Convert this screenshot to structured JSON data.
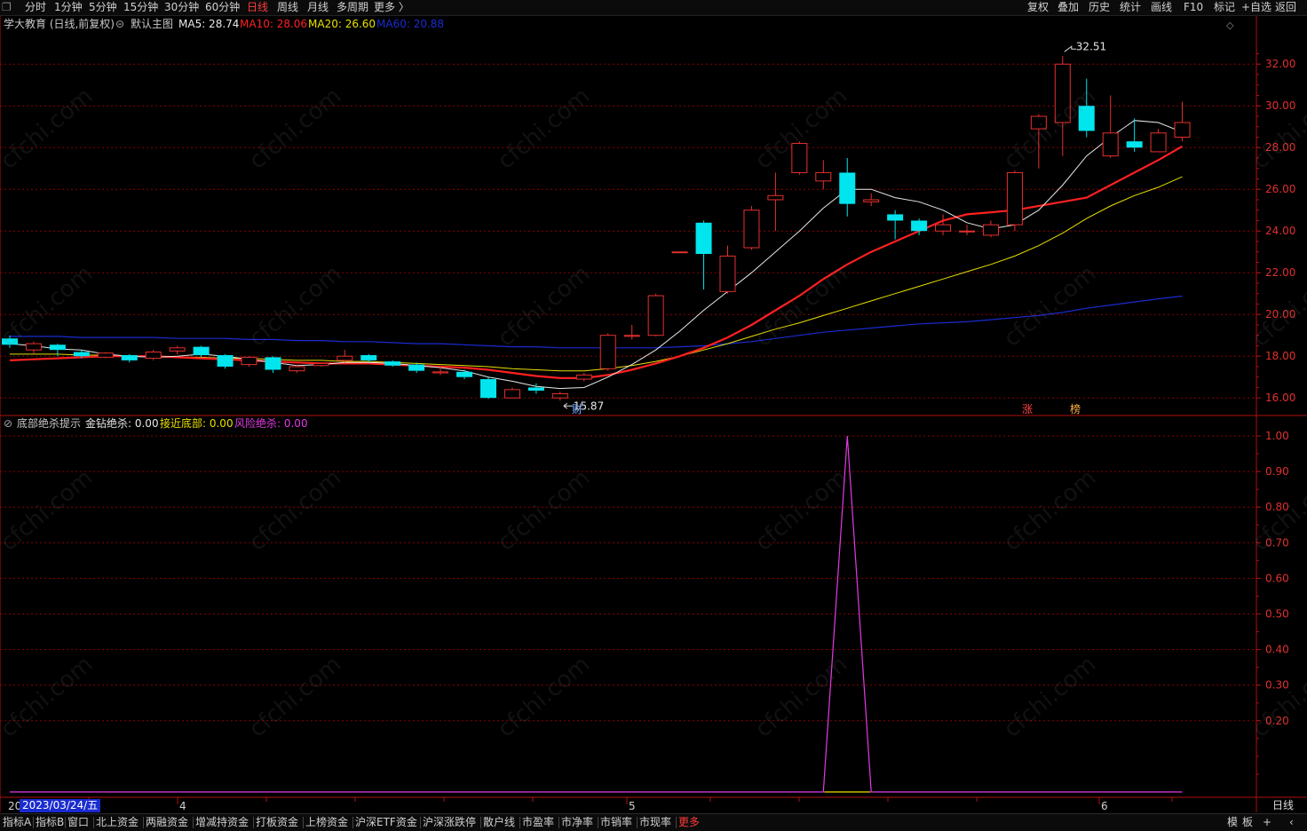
{
  "colors": {
    "up": "#e6302e",
    "down": "#00e5ee",
    "ma5": "#e8e8e8",
    "ma10": "#ff2020",
    "ma20": "#e8e000",
    "ma60": "#1a2bd0",
    "grid": "#8b0000",
    "signal": "#e23ae2"
  },
  "toolbar": {
    "left": [
      "分时",
      "1分钟",
      "5分钟",
      "15分钟",
      "30分钟",
      "60分钟",
      "日线",
      "周线",
      "月线",
      "多周期",
      "更多 〉"
    ],
    "active": "日线",
    "right": [
      "复权",
      "叠加",
      "历史",
      "统计",
      "画线",
      "F10",
      "标记",
      "+自选",
      "返回"
    ],
    "corner_icon": "expand-icon"
  },
  "main_panel": {
    "stock": "学大教育 (日线,前复权)",
    "template_icon": "circle-chevron-icon",
    "template": "默认主图",
    "ma_labels": [
      {
        "text": "MA5: 28.74",
        "color": "#e8e8e8"
      },
      {
        "text": "MA10: 28.06",
        "color": "#ff2020"
      },
      {
        "text": "MA20: 26.60",
        "color": "#e8e000"
      },
      {
        "text": "MA60: 20.88",
        "color": "#1a2bd0"
      }
    ],
    "price_axis": [
      "32.00",
      "30.00",
      "28.00",
      "26.00",
      "24.00",
      "22.00",
      "20.00",
      "18.00",
      "16.00"
    ],
    "high_marker": "32.51",
    "low_marker": "15.87",
    "events": [
      {
        "text": "财",
        "color": "#6fa8ff"
      },
      {
        "text": "涨",
        "color": "#ff4040"
      },
      {
        "text": "榜",
        "color": "#ffb040"
      }
    ]
  },
  "sub_panel": {
    "indicator": "底部绝杀提示",
    "labels": [
      {
        "text": "金钻绝杀: 0.00",
        "color": "#e8e8e8"
      },
      {
        "text": "接近底部: 0.00",
        "color": "#e8e000"
      },
      {
        "text": "风险绝杀: 0.00",
        "color": "#e23ae2"
      }
    ],
    "value_axis": [
      "1.00",
      "0.90",
      "0.80",
      "0.70",
      "0.60",
      "0.50",
      "0.40",
      "0.30",
      "0.20"
    ]
  },
  "time_axis": {
    "cursor_date": "2023/03/24/五",
    "year_prefix": "20",
    "months": [
      "4",
      "5",
      "6"
    ],
    "period": "日线"
  },
  "bottom_tabs": [
    "指标A",
    "指标B",
    "窗口",
    "北上资金",
    "两融资金",
    "增减持资金",
    "打板资金",
    "上榜资金",
    "沪深ETF资金",
    "沪深涨跌停",
    "散户线",
    "市盈率",
    "市净率",
    "市销率",
    "市现率",
    "更多"
  ],
  "bottom_right": [
    "模",
    "板",
    "+",
    "‹"
  ],
  "watermark": "cfchi.com",
  "chart_data": [
    {
      "type": "candlestick",
      "ylim": [
        15.2,
        33.5
      ],
      "candles": [
        [
          18.85,
          18.55,
          19.0,
          18.4
        ],
        [
          18.3,
          18.6,
          18.7,
          18.1
        ],
        [
          18.55,
          18.3,
          18.6,
          18.0
        ],
        [
          18.2,
          18.0,
          18.3,
          17.9
        ],
        [
          17.95,
          18.15,
          18.2,
          17.9
        ],
        [
          18.05,
          17.8,
          18.1,
          17.7
        ],
        [
          17.9,
          18.2,
          18.3,
          17.8
        ],
        [
          18.25,
          18.4,
          18.5,
          18.1
        ],
        [
          18.45,
          18.05,
          18.5,
          17.95
        ],
        [
          18.05,
          17.5,
          18.1,
          17.4
        ],
        [
          17.6,
          17.95,
          18.0,
          17.5
        ],
        [
          17.95,
          17.35,
          18.0,
          17.2
        ],
        [
          17.3,
          17.5,
          17.6,
          17.2
        ],
        [
          17.55,
          17.65,
          17.7,
          17.5
        ],
        [
          17.8,
          18.0,
          18.3,
          17.7
        ],
        [
          18.05,
          17.8,
          18.1,
          17.7
        ],
        [
          17.75,
          17.55,
          17.8,
          17.5
        ],
        [
          17.6,
          17.3,
          17.7,
          17.2
        ],
        [
          17.2,
          17.25,
          17.5,
          17.1
        ],
        [
          17.25,
          17.0,
          17.35,
          16.9
        ],
        [
          16.9,
          16.0,
          17.0,
          15.95
        ],
        [
          16.0,
          16.4,
          16.5,
          16.0
        ],
        [
          16.5,
          16.35,
          16.7,
          16.2
        ],
        [
          16.0,
          16.2,
          16.3,
          15.87
        ],
        [
          16.9,
          17.1,
          17.2,
          16.8
        ],
        [
          17.4,
          19.0,
          19.1,
          17.3
        ],
        [
          18.95,
          19.0,
          19.5,
          18.8
        ],
        [
          19.0,
          20.9,
          21.0,
          18.95
        ],
        [
          23.0,
          23.0,
          23.0,
          23.0
        ],
        [
          24.4,
          22.9,
          24.5,
          21.2
        ],
        [
          21.1,
          22.8,
          23.3,
          21.0
        ],
        [
          23.2,
          25.0,
          25.2,
          23.1
        ],
        [
          25.5,
          25.7,
          26.8,
          24.0
        ],
        [
          26.8,
          28.2,
          28.3,
          26.7
        ],
        [
          26.4,
          26.8,
          27.4,
          26.0
        ],
        [
          26.8,
          25.3,
          27.5,
          24.7
        ],
        [
          25.4,
          25.5,
          25.8,
          25.2
        ],
        [
          24.8,
          24.5,
          25.0,
          23.6
        ],
        [
          24.5,
          24.0,
          24.6,
          23.8
        ],
        [
          24.0,
          24.3,
          24.8,
          23.8
        ],
        [
          24.0,
          24.0,
          24.3,
          23.8
        ],
        [
          23.8,
          24.3,
          24.5,
          23.7
        ],
        [
          24.3,
          26.8,
          26.9,
          24.0
        ],
        [
          28.9,
          29.5,
          29.6,
          27.0
        ],
        [
          29.2,
          32.0,
          32.4,
          27.6
        ],
        [
          30.0,
          28.8,
          31.3,
          28.5
        ],
        [
          27.6,
          28.7,
          30.5,
          27.5
        ],
        [
          28.3,
          28.0,
          29.4,
          27.8
        ],
        [
          27.8,
          28.7,
          28.9,
          27.8
        ],
        [
          28.5,
          29.2,
          30.2,
          28.3
        ]
      ],
      "ma5": [
        18.6,
        18.5,
        18.35,
        18.3,
        18.1,
        18.0,
        17.95,
        18.0,
        18.1,
        18.0,
        17.85,
        17.7,
        17.55,
        17.6,
        17.7,
        17.7,
        17.65,
        17.55,
        17.45,
        17.3,
        17.0,
        16.8,
        16.55,
        16.45,
        16.5,
        17.0,
        17.6,
        18.3,
        19.2,
        20.2,
        21.1,
        22.0,
        23.0,
        24.0,
        25.1,
        26.0,
        26.0,
        25.6,
        25.4,
        25.0,
        24.4,
        24.1,
        24.3,
        25.0,
        26.2,
        27.6,
        28.5,
        29.3,
        29.2,
        28.74
      ],
      "ma10": [
        17.8,
        17.85,
        17.9,
        17.95,
        18.0,
        18.0,
        18.0,
        17.95,
        17.9,
        17.85,
        17.8,
        17.75,
        17.7,
        17.65,
        17.65,
        17.65,
        17.6,
        17.55,
        17.5,
        17.45,
        17.35,
        17.2,
        17.05,
        16.95,
        16.95,
        17.1,
        17.35,
        17.65,
        18.0,
        18.4,
        18.9,
        19.5,
        20.2,
        20.9,
        21.7,
        22.4,
        23.0,
        23.5,
        24.0,
        24.5,
        24.8,
        24.9,
        25.0,
        25.2,
        25.4,
        25.6,
        26.2,
        26.8,
        27.4,
        28.06
      ],
      "ma20": [
        18.1,
        18.1,
        18.1,
        18.05,
        18.05,
        18.0,
        18.0,
        17.95,
        17.95,
        17.9,
        17.9,
        17.85,
        17.8,
        17.8,
        17.75,
        17.75,
        17.7,
        17.65,
        17.6,
        17.55,
        17.5,
        17.4,
        17.35,
        17.3,
        17.3,
        17.4,
        17.55,
        17.75,
        18.0,
        18.3,
        18.6,
        18.95,
        19.3,
        19.6,
        19.95,
        20.3,
        20.65,
        21.0,
        21.35,
        21.7,
        22.05,
        22.4,
        22.8,
        23.3,
        23.9,
        24.6,
        25.2,
        25.7,
        26.1,
        26.6
      ],
      "ma60": [
        18.95,
        18.95,
        18.95,
        18.9,
        18.9,
        18.9,
        18.9,
        18.85,
        18.85,
        18.85,
        18.8,
        18.8,
        18.75,
        18.75,
        18.7,
        18.7,
        18.65,
        18.6,
        18.6,
        18.55,
        18.5,
        18.45,
        18.45,
        18.4,
        18.4,
        18.4,
        18.4,
        18.4,
        18.45,
        18.5,
        18.6,
        18.7,
        18.85,
        19.0,
        19.15,
        19.25,
        19.35,
        19.45,
        19.55,
        19.6,
        19.65,
        19.75,
        19.85,
        19.95,
        20.1,
        20.3,
        20.45,
        20.6,
        20.75,
        20.88
      ]
    },
    {
      "type": "line",
      "ylim": [
        0,
        1
      ],
      "series": [
        {
          "name": "风险绝杀",
          "values": [
            0,
            0,
            0,
            0,
            0,
            0,
            0,
            0,
            0,
            0,
            0,
            0,
            0,
            0,
            0,
            0,
            0,
            0,
            0,
            0,
            0,
            0,
            0,
            0,
            0,
            0,
            0,
            0,
            0,
            0,
            0,
            0,
            0,
            0,
            0,
            1,
            0,
            0,
            0,
            0,
            0,
            0,
            0,
            0,
            0,
            0,
            0,
            0,
            0,
            0
          ]
        }
      ]
    }
  ]
}
